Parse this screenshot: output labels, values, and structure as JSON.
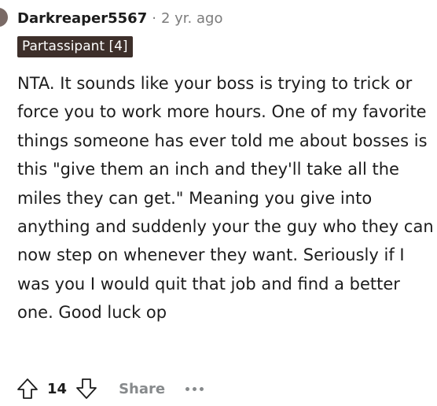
{
  "comment": {
    "username": "Darkreaper5567",
    "separator": "·",
    "time": "2 yr. ago",
    "flair": "Partassipant [4]",
    "body": "NTA. It sounds like your boss is trying to trick or force you to work more hours. One of my favorite things someone has ever told me about bosses is this \"give them an inch and they'll take all the miles they can get.\" Meaning you give into anything and suddenly your the guy who they can now step on whenever they want. Seriously if I was you I would quit that job and find a better one. Good luck op",
    "score": "14",
    "share_label": "Share"
  },
  "icons": {
    "upvote": "upvote-arrow-icon",
    "downvote": "downvote-arrow-icon",
    "more": "more-options-icon"
  },
  "colors": {
    "flair_bg": "#3d2f2a",
    "flair_text": "#ffffff",
    "muted": "#878a8c",
    "text": "#1c1c1c"
  }
}
